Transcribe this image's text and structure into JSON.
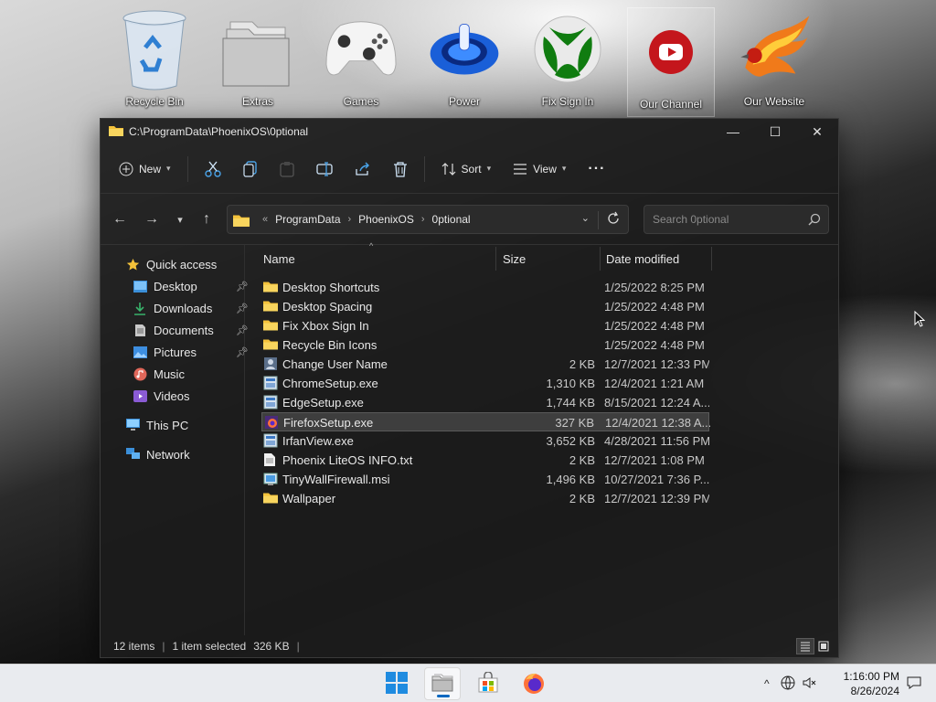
{
  "desktop": {
    "icons": [
      {
        "label": "Recycle Bin",
        "icon": "recycle-bin-icon"
      },
      {
        "label": "Extras",
        "icon": "folder-stack-icon"
      },
      {
        "label": "Games",
        "icon": "game-controller-icon"
      },
      {
        "label": "Power",
        "icon": "power-icon"
      },
      {
        "label": "Fix Sign In",
        "icon": "xbox-icon"
      },
      {
        "label": "Our Channel",
        "icon": "youtube-icon"
      },
      {
        "label": "Our Website",
        "icon": "phoenix-logo-icon"
      }
    ]
  },
  "window": {
    "title": "C:\\ProgramData\\PhoenixOS\\0ptional",
    "controls": {
      "minimize": "—",
      "maximize": "☐",
      "close": "✕"
    }
  },
  "toolbar": {
    "new_label": "New",
    "sort_label": "Sort",
    "view_label": "View",
    "more_label": "···"
  },
  "address": {
    "crumbs": [
      "ProgramData",
      "PhoenixOS",
      "0ptional"
    ],
    "overflow": "«"
  },
  "search": {
    "placeholder": "Search 0ptional"
  },
  "nav": {
    "quick_access": "Quick access",
    "items": [
      {
        "label": "Desktop",
        "pinned": true
      },
      {
        "label": "Downloads",
        "pinned": true
      },
      {
        "label": "Documents",
        "pinned": true
      },
      {
        "label": "Pictures",
        "pinned": true
      },
      {
        "label": "Music",
        "pinned": false
      },
      {
        "label": "Videos",
        "pinned": false
      }
    ],
    "this_pc": "This PC",
    "network": "Network"
  },
  "columns": {
    "name": "Name",
    "size": "Size",
    "date": "Date modified"
  },
  "files": [
    {
      "name": "Desktop Shortcuts",
      "size": "",
      "date": "1/25/2022 8:25 PM",
      "type": "folder"
    },
    {
      "name": "Desktop Spacing",
      "size": "",
      "date": "1/25/2022 4:48 PM",
      "type": "folder"
    },
    {
      "name": "Fix Xbox Sign In",
      "size": "",
      "date": "1/25/2022 4:48 PM",
      "type": "folder"
    },
    {
      "name": "Recycle Bin Icons",
      "size": "",
      "date": "1/25/2022 4:48 PM",
      "type": "folder"
    },
    {
      "name": "Change User Name",
      "size": "2 KB",
      "date": "12/7/2021 12:33 PM",
      "type": "shortcut"
    },
    {
      "name": "ChromeSetup.exe",
      "size": "1,310 KB",
      "date": "12/4/2021 1:21 AM",
      "type": "exe"
    },
    {
      "name": "EdgeSetup.exe",
      "size": "1,744 KB",
      "date": "8/15/2021 12:24 A...",
      "type": "exe"
    },
    {
      "name": "FirefoxSetup.exe",
      "size": "327 KB",
      "date": "12/4/2021 12:38 A...",
      "type": "exe-firefox"
    },
    {
      "name": "IrfanView.exe",
      "size": "3,652 KB",
      "date": "4/28/2021 11:56 PM",
      "type": "exe"
    },
    {
      "name": "Phoenix LiteOS INFO.txt",
      "size": "2 KB",
      "date": "12/7/2021 1:08 PM",
      "type": "txt"
    },
    {
      "name": "TinyWallFirewall.msi",
      "size": "1,496 KB",
      "date": "10/27/2021 7:36 P...",
      "type": "msi"
    },
    {
      "name": "Wallpaper",
      "size": "2 KB",
      "date": "12/7/2021 12:39 PM",
      "type": "folder"
    }
  ],
  "selected_index": 7,
  "status": {
    "items": "12 items",
    "selected": "1 item selected",
    "size": "326 KB"
  },
  "taskbar": {
    "apps": [
      "start-icon",
      "file-explorer-icon",
      "store-icon",
      "firefox-icon"
    ],
    "time": "1:16:00 PM",
    "date": "8/26/2024"
  },
  "colors": {
    "accent": "#0067c0",
    "folder": "#f3c13a",
    "window_bg": "#1c1c1c"
  }
}
